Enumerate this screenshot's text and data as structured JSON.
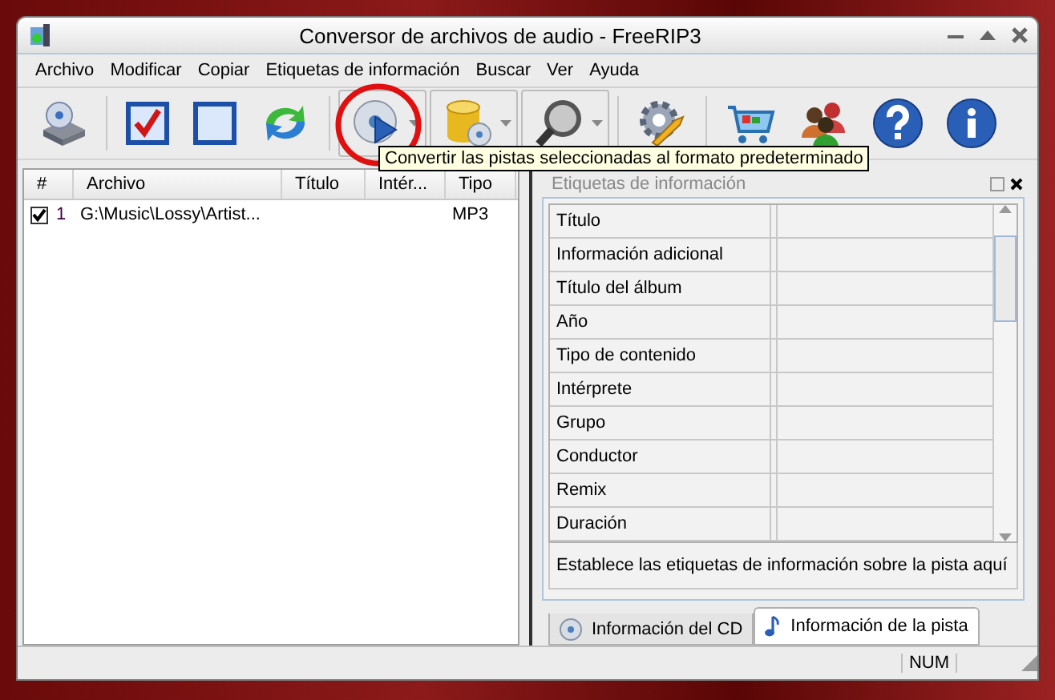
{
  "window": {
    "title": "Conversor de archivos de audio - FreeRIP3"
  },
  "menu": [
    "Archivo",
    "Modificar",
    "Copiar",
    "Etiquetas de información",
    "Buscar",
    "Ver",
    "Ayuda"
  ],
  "tooltip": "Convertir las pistas seleccionadas al formato predeterminado",
  "track_list": {
    "columns": [
      "#",
      "Archivo",
      "Título",
      "Intér...",
      "Tipo"
    ],
    "rows": [
      {
        "checked": true,
        "number": "1",
        "file": "G:\\Music\\Lossy\\Artist...",
        "title_cell": "",
        "type": "MP3"
      }
    ]
  },
  "info_panel": {
    "title": "Etiquetas de información",
    "fields": [
      "Título",
      "Información adicional",
      "Título del álbum",
      "Año",
      "Tipo de contenido",
      "Intérprete",
      "Grupo",
      "Conductor",
      "Remix",
      "Duración"
    ],
    "description": "Establece las etiquetas de información sobre la pista aquí",
    "tabs": [
      {
        "label": "Información del CD",
        "kind": "cd",
        "selected": false
      },
      {
        "label": "Información de la pista",
        "kind": "note",
        "selected": true
      }
    ]
  },
  "status_bar": {
    "num": "NUM"
  }
}
